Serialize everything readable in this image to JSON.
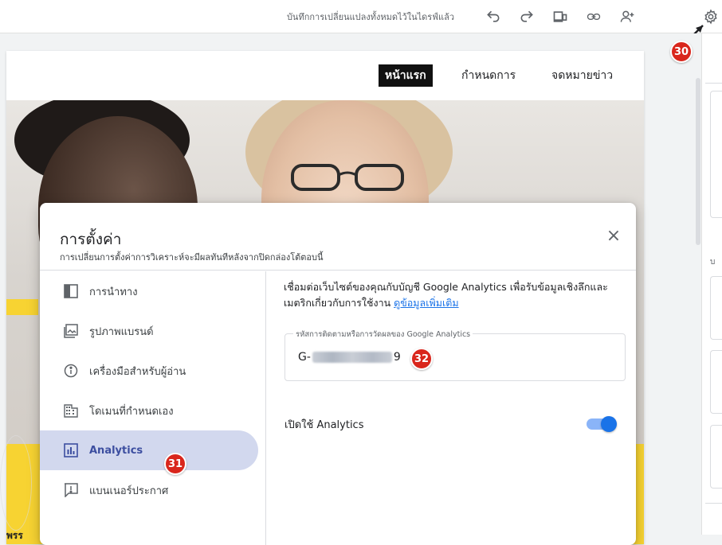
{
  "topbar": {
    "status_text": "บันทึกการเปลี่ยนแปลงทั้งหมดไว้ในไดรฟ์แล้ว",
    "icons": [
      "undo-icon",
      "redo-icon",
      "preview-icon",
      "link-icon",
      "share-icon",
      "gear-icon"
    ]
  },
  "site": {
    "nav": [
      "หน้าแรก",
      "กำหนดการ",
      "จดหมายข่าว"
    ],
    "hero_text": "พรร"
  },
  "right_panel": {
    "letter": "บ"
  },
  "dialog": {
    "title": "การตั้งค่า",
    "subtitle": "การเปลี่ยนการตั้งค่าการวิเคราะห์จะมีผลทันทีหลังจากปิดกล่องโต้ตอบนี้",
    "close": "×",
    "sidebar": [
      {
        "label": "การนำทาง",
        "icon": "navigation-icon"
      },
      {
        "label": "รูปภาพแบรนด์",
        "icon": "image-icon"
      },
      {
        "label": "เครื่องมือสำหรับผู้อ่าน",
        "icon": "info-icon"
      },
      {
        "label": "โดเมนที่กำหนดเอง",
        "icon": "domain-icon"
      },
      {
        "label": "Analytics",
        "icon": "analytics-icon",
        "active": true
      },
      {
        "label": "แบนเนอร์ประกาศ",
        "icon": "announcement-icon"
      }
    ],
    "description": "เชื่อมต่อเว็บไซต์ของคุณกับบัญชี Google Analytics เพื่อรับข้อมูลเชิงลึกและเมตริกเกี่ยวกับการใช้งาน",
    "learn_more": "ดูข้อมูลเพิ่มเติม",
    "field": {
      "label": "รหัสการติดตามหรือการวัดผลของ Google Analytics",
      "prefix": "G-",
      "suffix": "9"
    },
    "toggle": {
      "label": "เปิดใช้ Analytics",
      "on": true
    }
  },
  "badges": {
    "b30": "30",
    "b31": "31",
    "b32": "32"
  },
  "colors": {
    "badge": "#d9261c",
    "accent": "#1a73e8",
    "active_item": "#d2d8ee",
    "yellow": "#f7d332"
  }
}
